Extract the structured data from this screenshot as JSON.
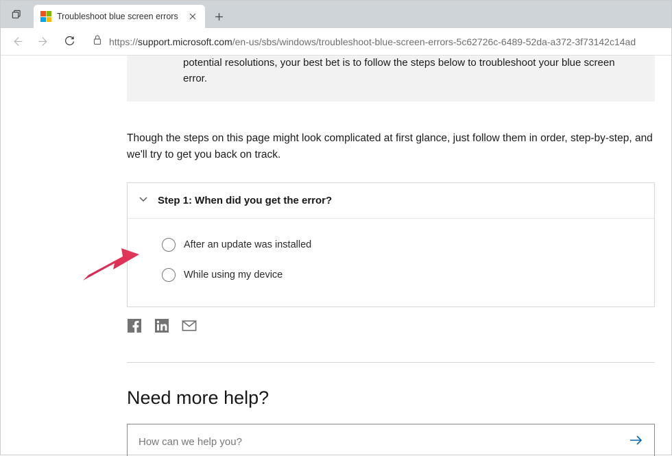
{
  "browser": {
    "tab_title": "Troubleshoot blue screen errors",
    "url_scheme": "https://",
    "url_host": "support.microsoft.com",
    "url_path": "/en-us/sbs/windows/troubleshoot-blue-screen-errors-5c62726c-6489-52da-a372-3f73142c14ad"
  },
  "note": "potential resolutions, your best bet is to follow the steps below to troubleshoot your blue screen error.",
  "intro": "Though the steps on this page might look complicated at first glance, just follow them in order, step-by-step, and we'll try to get you back on track.",
  "step": {
    "title": "Step 1: When did you get the error?",
    "options": [
      "After an update was installed",
      "While using my device"
    ]
  },
  "help": {
    "heading": "Need more help?",
    "placeholder": "How can we help you?"
  }
}
